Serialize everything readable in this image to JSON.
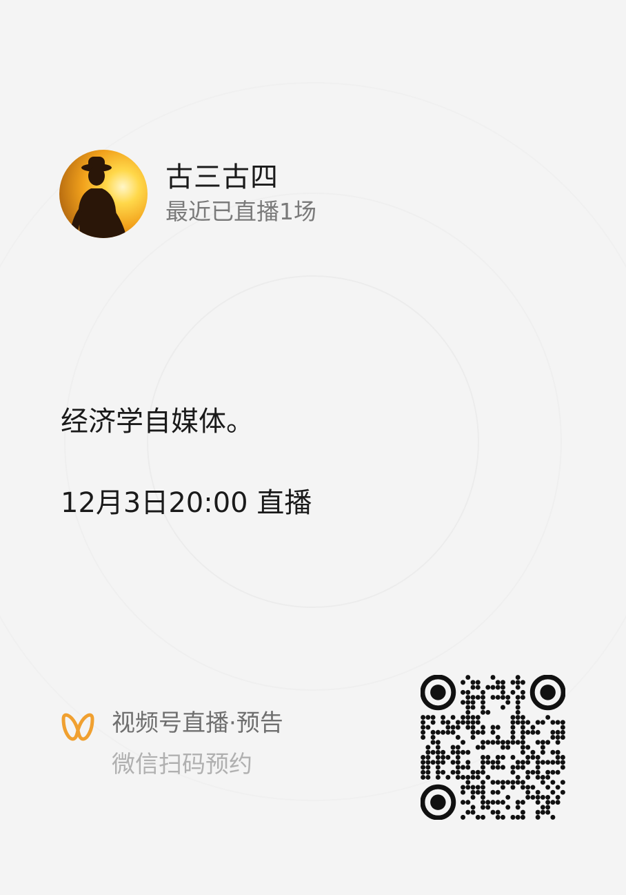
{
  "author": {
    "name": "古三古四",
    "subtitle": "最近已直播1场"
  },
  "description": "经济学自媒体。",
  "schedule": "12月3日20:00 直播",
  "footer": {
    "title": "视频号直播·预告",
    "subtitle": "微信扫码预约",
    "logo_icon": "channels-butterfly-icon",
    "logo_color": "#f0a030"
  },
  "qr_icon": "qr-code-icon"
}
